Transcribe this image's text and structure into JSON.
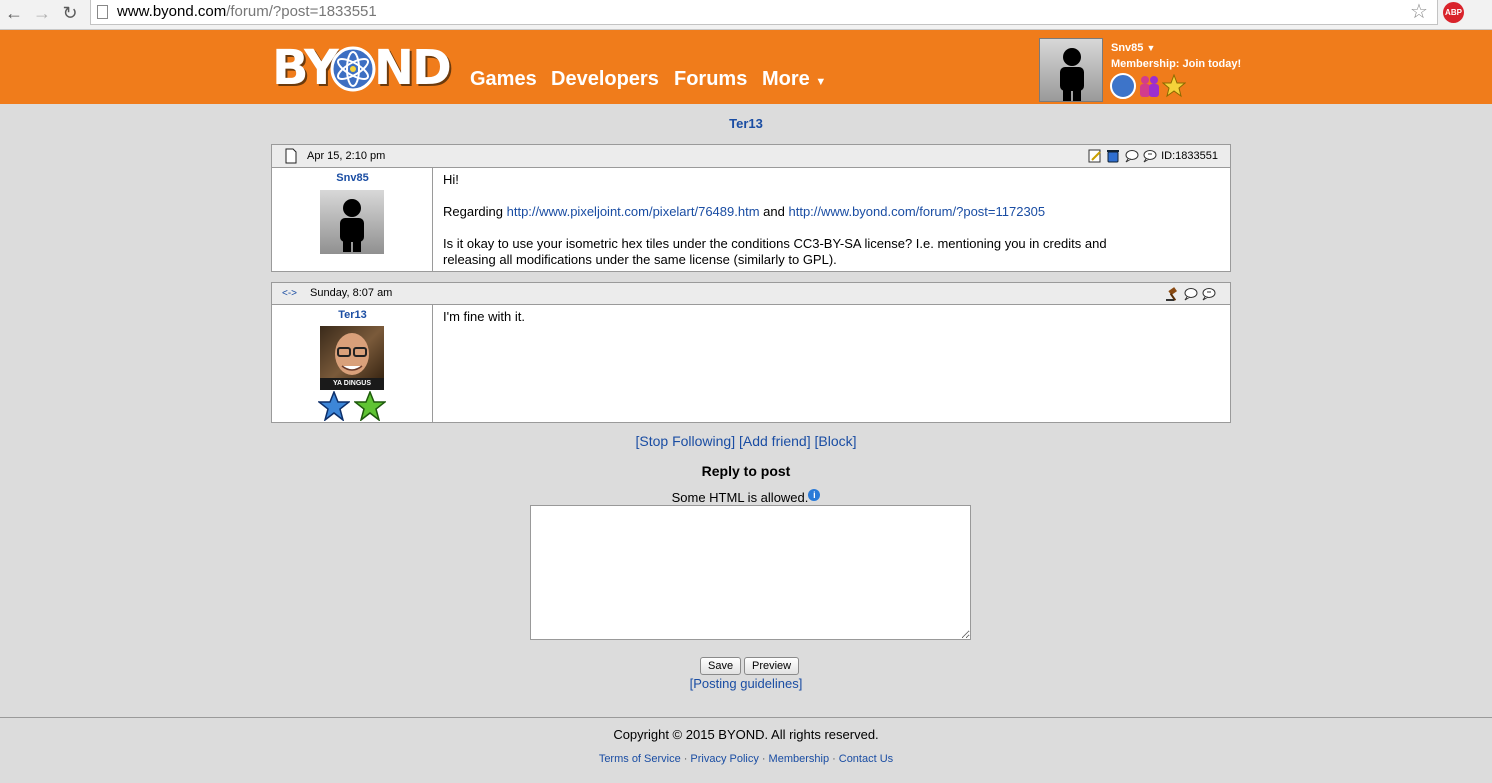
{
  "browser": {
    "url_host": "www.byond.com",
    "url_path": "/forum/?post=1833551",
    "abp_label": "ABP"
  },
  "header": {
    "logo_text": "BYOND",
    "nav": [
      "Games",
      "Developers",
      "Forums",
      "More"
    ],
    "user_name": "Snv85",
    "membership_text": "Membership: Join today!"
  },
  "thread": {
    "title": "Ter13"
  },
  "posts": [
    {
      "date": "Apr 15, 2:10 pm",
      "id_label": "ID:1833551",
      "author": "Snv85",
      "line1": "Hi!",
      "regarding": "Regarding",
      "link1": "http://www.pixeljoint.com/pixelart/76489.htm",
      "and": "and",
      "link2": "http://www.byond.com/forum/?post=1172305",
      "line3": "Is it okay to use your isometric hex tiles under the conditions CC3-BY-SA license? I.e. mentioning you in credits and",
      "line4": "releasing all modifications under the same license (similarly to GPL)."
    },
    {
      "nav_arrow": "<->",
      "date": "Sunday, 8:07 am",
      "author": "Ter13",
      "avatar_caption": "YA DINGUS",
      "text": "I'm fine with it."
    }
  ],
  "actions": {
    "stop_following": "[Stop Following]",
    "add_friend": "[Add friend]",
    "block": "[Block]"
  },
  "reply": {
    "title": "Reply to post",
    "html_note": "Some HTML is allowed.",
    "save": "Save",
    "preview": "Preview",
    "guidelines": "[Posting guidelines]"
  },
  "footer": {
    "copyright": "Copyright © 2015 BYOND. All rights reserved.",
    "links": [
      "Terms of Service",
      "Privacy Policy",
      "Membership",
      "Contact Us"
    ]
  }
}
